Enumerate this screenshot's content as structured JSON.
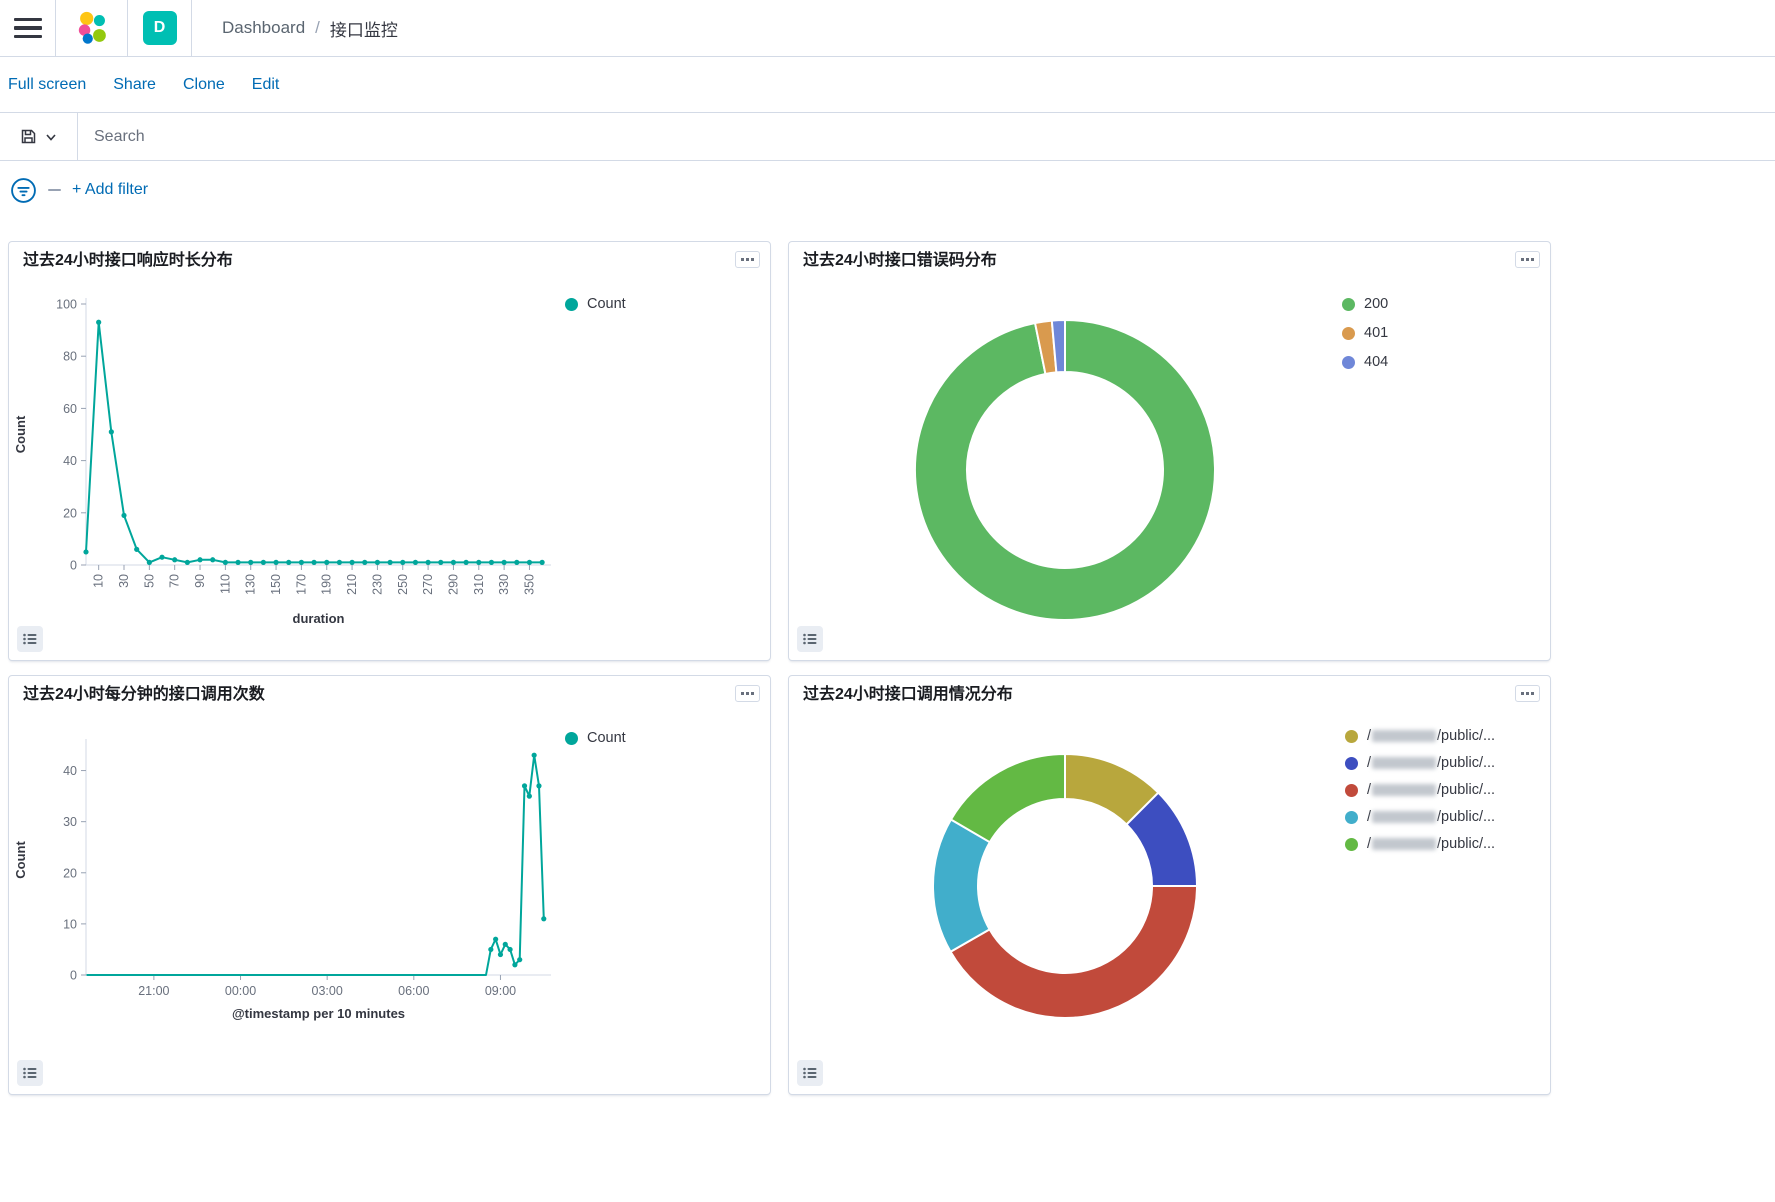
{
  "colors": {
    "accent_link": "#006BB4",
    "brand_teal": "#00BFB3",
    "series_teal": "#00A69B",
    "border": "#D3DAE6"
  },
  "header": {
    "space_badge": "D",
    "breadcrumbs": [
      {
        "label": "Dashboard"
      },
      {
        "label": "接口监控"
      }
    ],
    "breadcrumb_separator": "/"
  },
  "menubar": {
    "items": [
      {
        "label": "Full screen"
      },
      {
        "label": "Share"
      },
      {
        "label": "Clone"
      },
      {
        "label": "Edit"
      }
    ]
  },
  "search": {
    "placeholder": "Search"
  },
  "filter_bar": {
    "add_filter_label": "+ Add filter"
  },
  "panels": [
    {
      "title": "过去24小时接口响应时长分布"
    },
    {
      "title": "过去24小时接口错误码分布"
    },
    {
      "title": "过去24小时每分钟的接口调用次数"
    },
    {
      "title": "过去24小时接口调用情况分布"
    }
  ],
  "chart_data": [
    {
      "type": "line",
      "title": "过去24小时接口响应时长分布",
      "xlabel": "duration",
      "ylabel": "Count",
      "color": "#00A69B",
      "legend": [
        {
          "label": "Count",
          "color": "#00A69B"
        }
      ],
      "xlim": [
        0,
        367
      ],
      "ylim": [
        0,
        100
      ],
      "x_ticks": [
        10,
        30,
        50,
        70,
        90,
        110,
        130,
        150,
        170,
        190,
        210,
        230,
        250,
        270,
        290,
        310,
        330,
        350
      ],
      "y_ticks": [
        0,
        20,
        40,
        60,
        80,
        100
      ],
      "points": [
        [
          0,
          5
        ],
        [
          10,
          93
        ],
        [
          20,
          51
        ],
        [
          30,
          19
        ],
        [
          40,
          6
        ],
        [
          50,
          1
        ],
        [
          60,
          3
        ],
        [
          70,
          2
        ],
        [
          80,
          1
        ],
        [
          90,
          2
        ],
        [
          100,
          2
        ],
        [
          110,
          1
        ],
        [
          120,
          1
        ],
        [
          130,
          1
        ],
        [
          140,
          1
        ],
        [
          150,
          1
        ],
        [
          160,
          1
        ],
        [
          170,
          1
        ],
        [
          180,
          1
        ],
        [
          190,
          1
        ],
        [
          200,
          1
        ],
        [
          210,
          1
        ],
        [
          220,
          1
        ],
        [
          230,
          1
        ],
        [
          240,
          1
        ],
        [
          250,
          1
        ],
        [
          260,
          1
        ],
        [
          270,
          1
        ],
        [
          280,
          1
        ],
        [
          290,
          1
        ],
        [
          300,
          1
        ],
        [
          310,
          1
        ],
        [
          320,
          1
        ],
        [
          330,
          1
        ],
        [
          340,
          1
        ],
        [
          350,
          1
        ],
        [
          360,
          1
        ]
      ]
    },
    {
      "type": "pie",
      "donut": true,
      "title": "过去24小时接口错误码分布",
      "legend_position": "right",
      "slices": [
        {
          "label": "200",
          "value": 96.8,
          "color": "#5CB862"
        },
        {
          "label": "401",
          "value": 1.8,
          "color": "#D99A4E"
        },
        {
          "label": "404",
          "value": 1.4,
          "color": "#6F87D8"
        }
      ]
    },
    {
      "type": "line",
      "title": "过去24小时每分钟的接口调用次数",
      "xlabel": "@timestamp per 10 minutes",
      "ylabel": "Count",
      "color": "#00A69B",
      "legend": [
        {
          "label": "Count",
          "color": "#00A69B"
        }
      ],
      "x_type": "time",
      "xlim_hours": [
        18.65,
        34.75
      ],
      "ylim": [
        0,
        45
      ],
      "x_ticks": [
        "21:00",
        "00:00",
        "03:00",
        "06:00",
        "09:00"
      ],
      "y_ticks": [
        0,
        10,
        20,
        30,
        40
      ],
      "points": [
        [
          "18:40",
          0
        ],
        [
          "19:00",
          0
        ],
        [
          "20:00",
          0
        ],
        [
          "21:00",
          0
        ],
        [
          "22:00",
          0
        ],
        [
          "23:00",
          0
        ],
        [
          "00:00",
          0
        ],
        [
          "01:00",
          0
        ],
        [
          "02:00",
          0
        ],
        [
          "03:00",
          0
        ],
        [
          "04:00",
          0
        ],
        [
          "05:00",
          0
        ],
        [
          "06:00",
          0
        ],
        [
          "07:00",
          0
        ],
        [
          "08:00",
          0
        ],
        [
          "08:30",
          0
        ],
        [
          "08:40",
          5
        ],
        [
          "08:50",
          7
        ],
        [
          "09:00",
          4
        ],
        [
          "09:10",
          6
        ],
        [
          "09:20",
          5
        ],
        [
          "09:30",
          2
        ],
        [
          "09:40",
          3
        ],
        [
          "09:50",
          37
        ],
        [
          "10:00",
          35
        ],
        [
          "10:10",
          43
        ],
        [
          "10:20",
          37
        ],
        [
          "10:30",
          11
        ]
      ]
    },
    {
      "type": "pie",
      "donut": true,
      "title": "过去24小时接口调用情况分布",
      "legend_position": "right",
      "slices": [
        {
          "label_prefix": "/",
          "label_suffix": "/public/...",
          "redacted": true,
          "value": 12.5,
          "color": "#B8A73D"
        },
        {
          "label_prefix": "/",
          "label_suffix": "/public/...",
          "redacted": true,
          "value": 12.5,
          "color": "#3D4EC0"
        },
        {
          "label_prefix": "/",
          "label_suffix": "/public/...",
          "redacted": true,
          "value": 41.7,
          "color": "#C14A3B"
        },
        {
          "label_prefix": "/",
          "label_suffix": "/public/...",
          "redacted": true,
          "value": 16.7,
          "color": "#41AECB"
        },
        {
          "label_prefix": "/",
          "label_suffix": "/public/...",
          "redacted": true,
          "value": 16.6,
          "color": "#63B944"
        }
      ]
    }
  ]
}
